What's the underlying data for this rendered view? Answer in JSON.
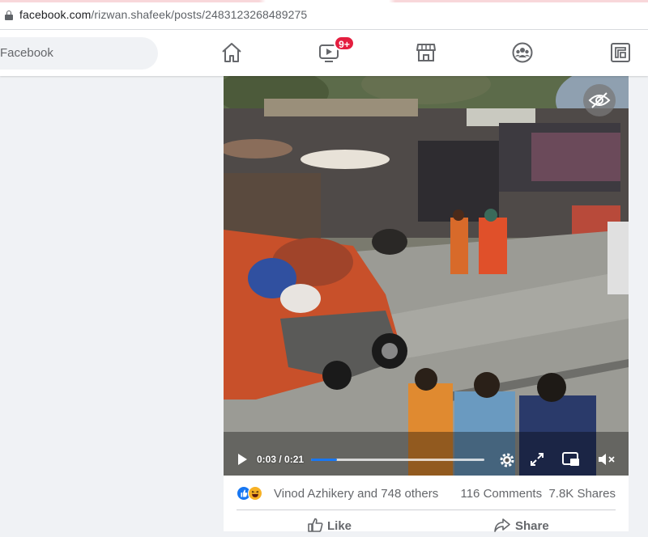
{
  "browser": {
    "url_domain": "facebook.com",
    "url_path": "/rizwan.shafeek/posts/2483123268489275"
  },
  "header": {
    "search_text": "Facebook",
    "watch_badge": "9+"
  },
  "video": {
    "current_time": "0:03",
    "duration": "0:21",
    "progress": 0.15
  },
  "post": {
    "reactions_text": "Vinod Azhikery and 748 others",
    "comments": "116 Comments",
    "shares": "7.8K Shares",
    "like_label": "Like",
    "share_label": "Share"
  },
  "colors": {
    "brand": "#1877f2",
    "badge": "#e41e3f"
  }
}
